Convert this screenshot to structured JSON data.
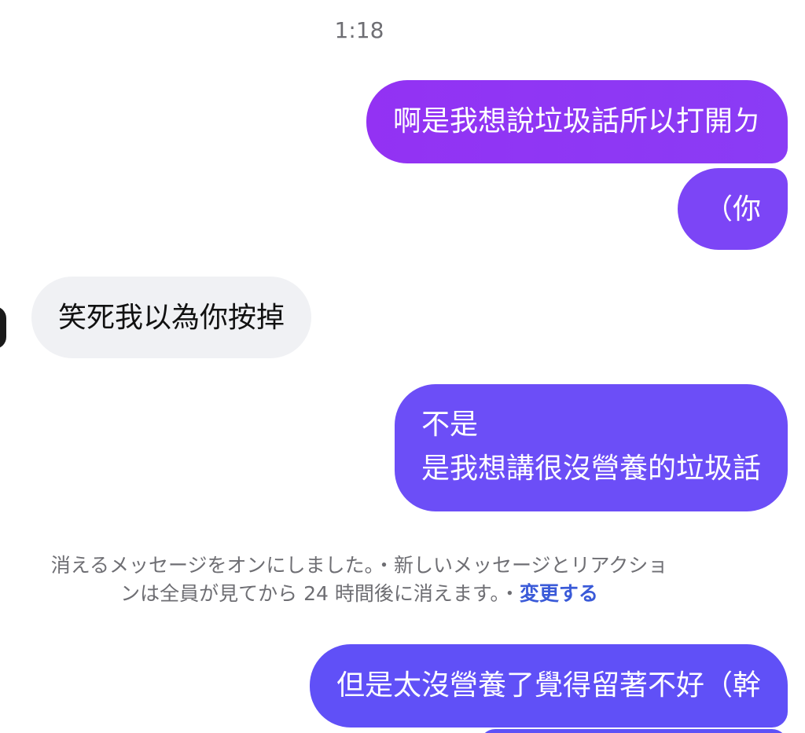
{
  "conversation": {
    "timestamp": "1:18",
    "messages": [
      {
        "direction": "outgoing",
        "lines": [
          "啊是我想說垃圾話所以打開ㄉ"
        ]
      },
      {
        "direction": "outgoing",
        "lines": [
          "（你"
        ]
      },
      {
        "direction": "incoming",
        "lines": [
          "笑死我以為你按掉"
        ]
      },
      {
        "direction": "outgoing",
        "lines": [
          "不是",
          "是我想講很沒營養的垃圾話"
        ]
      },
      {
        "direction": "outgoing",
        "lines": [
          "但是太沒營養了覺得留著不好（幹"
        ]
      }
    ],
    "system_notice": {
      "line1": "消えるメッセージをオンにしました。・新しいメッセージとリアクショ",
      "line2": "ンは全員が見てから 24 時間後に消えます。・",
      "link_label": "変更する"
    }
  },
  "colors": {
    "outgoing_top": "#9332f3",
    "outgoing_bottom": "#6050f7",
    "incoming": "#f0f1f4",
    "link": "#3a5ad8"
  }
}
